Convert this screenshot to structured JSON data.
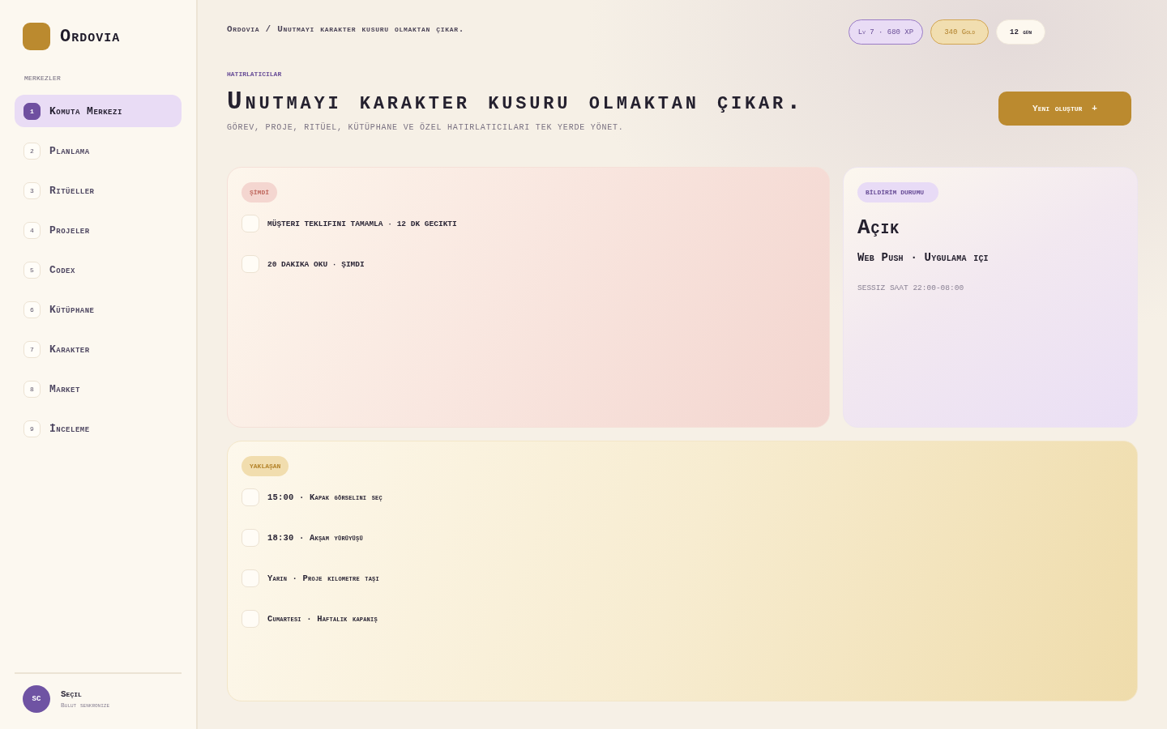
{
  "brand": {
    "name": "Ordovia"
  },
  "sidebar": {
    "section_label": "MERKEZLER",
    "items": [
      {
        "number": "1",
        "label": "Komuta Merkezi",
        "selected": true
      },
      {
        "number": "2",
        "label": "Planlama",
        "selected": false
      },
      {
        "number": "3",
        "label": "Ritüeller",
        "selected": false
      },
      {
        "number": "4",
        "label": "Projeler",
        "selected": false
      },
      {
        "number": "5",
        "label": "Codex",
        "selected": false
      },
      {
        "number": "6",
        "label": "Kütüphane",
        "selected": false
      },
      {
        "number": "7",
        "label": "Karakter",
        "selected": false
      },
      {
        "number": "8",
        "label": "Market",
        "selected": false
      },
      {
        "number": "9",
        "label": "İnceleme",
        "selected": false
      }
    ]
  },
  "user": {
    "initials": "SC",
    "name": "Seçil",
    "status": "Bulut senkronize"
  },
  "breadcrumb": "Ordovia / Unutmayı karakter kusuru olmaktan çıkar.",
  "chips": [
    {
      "kind": "level",
      "text": "Lv 7 · 680 XP"
    },
    {
      "kind": "gold",
      "text": "340 Gold"
    },
    {
      "kind": "streak",
      "text": "12 gün"
    }
  ],
  "hero": {
    "eyebrow": "HATIRLATICILAR",
    "title": "Unutmayı karakter kusuru olmaktan çıkar.",
    "subtitle": "GÖREV, PROJE, RITÜEL, KÜTÜPHANE VE ÖZEL HATIRLATICILARI TEK YERDE YÖNET.",
    "create_button": {
      "label": "Yeni oluştur",
      "icon": "+"
    }
  },
  "now_card": {
    "badge": "ŞİMDİ",
    "tasks": [
      {
        "text": "MÜŞTERI TEKLIFINI TAMAMLA · 12 DK GECIKTI",
        "checked": false
      },
      {
        "text": "20 DAKIKA OKU · ŞIMDI",
        "checked": false
      }
    ]
  },
  "notification_card": {
    "badge": "BİLDİRİM DURUMU",
    "status": "Açık",
    "channels": "Web Push · Uygulama içi",
    "quiet_hours": "SESSIZ SAAT 22:00-08:00"
  },
  "upcoming_card": {
    "badge": "YAKLAŞAN",
    "tasks": [
      {
        "text": "15:00 · Kapak görselini seç",
        "checked": false
      },
      {
        "text": "18:30 · Akşam yürüyüşü",
        "checked": false
      },
      {
        "text": "Yarın · Proje kilometre taşı",
        "checked": false
      },
      {
        "text": "Cumartesi · Haftalık kapanış",
        "checked": false
      }
    ]
  }
}
